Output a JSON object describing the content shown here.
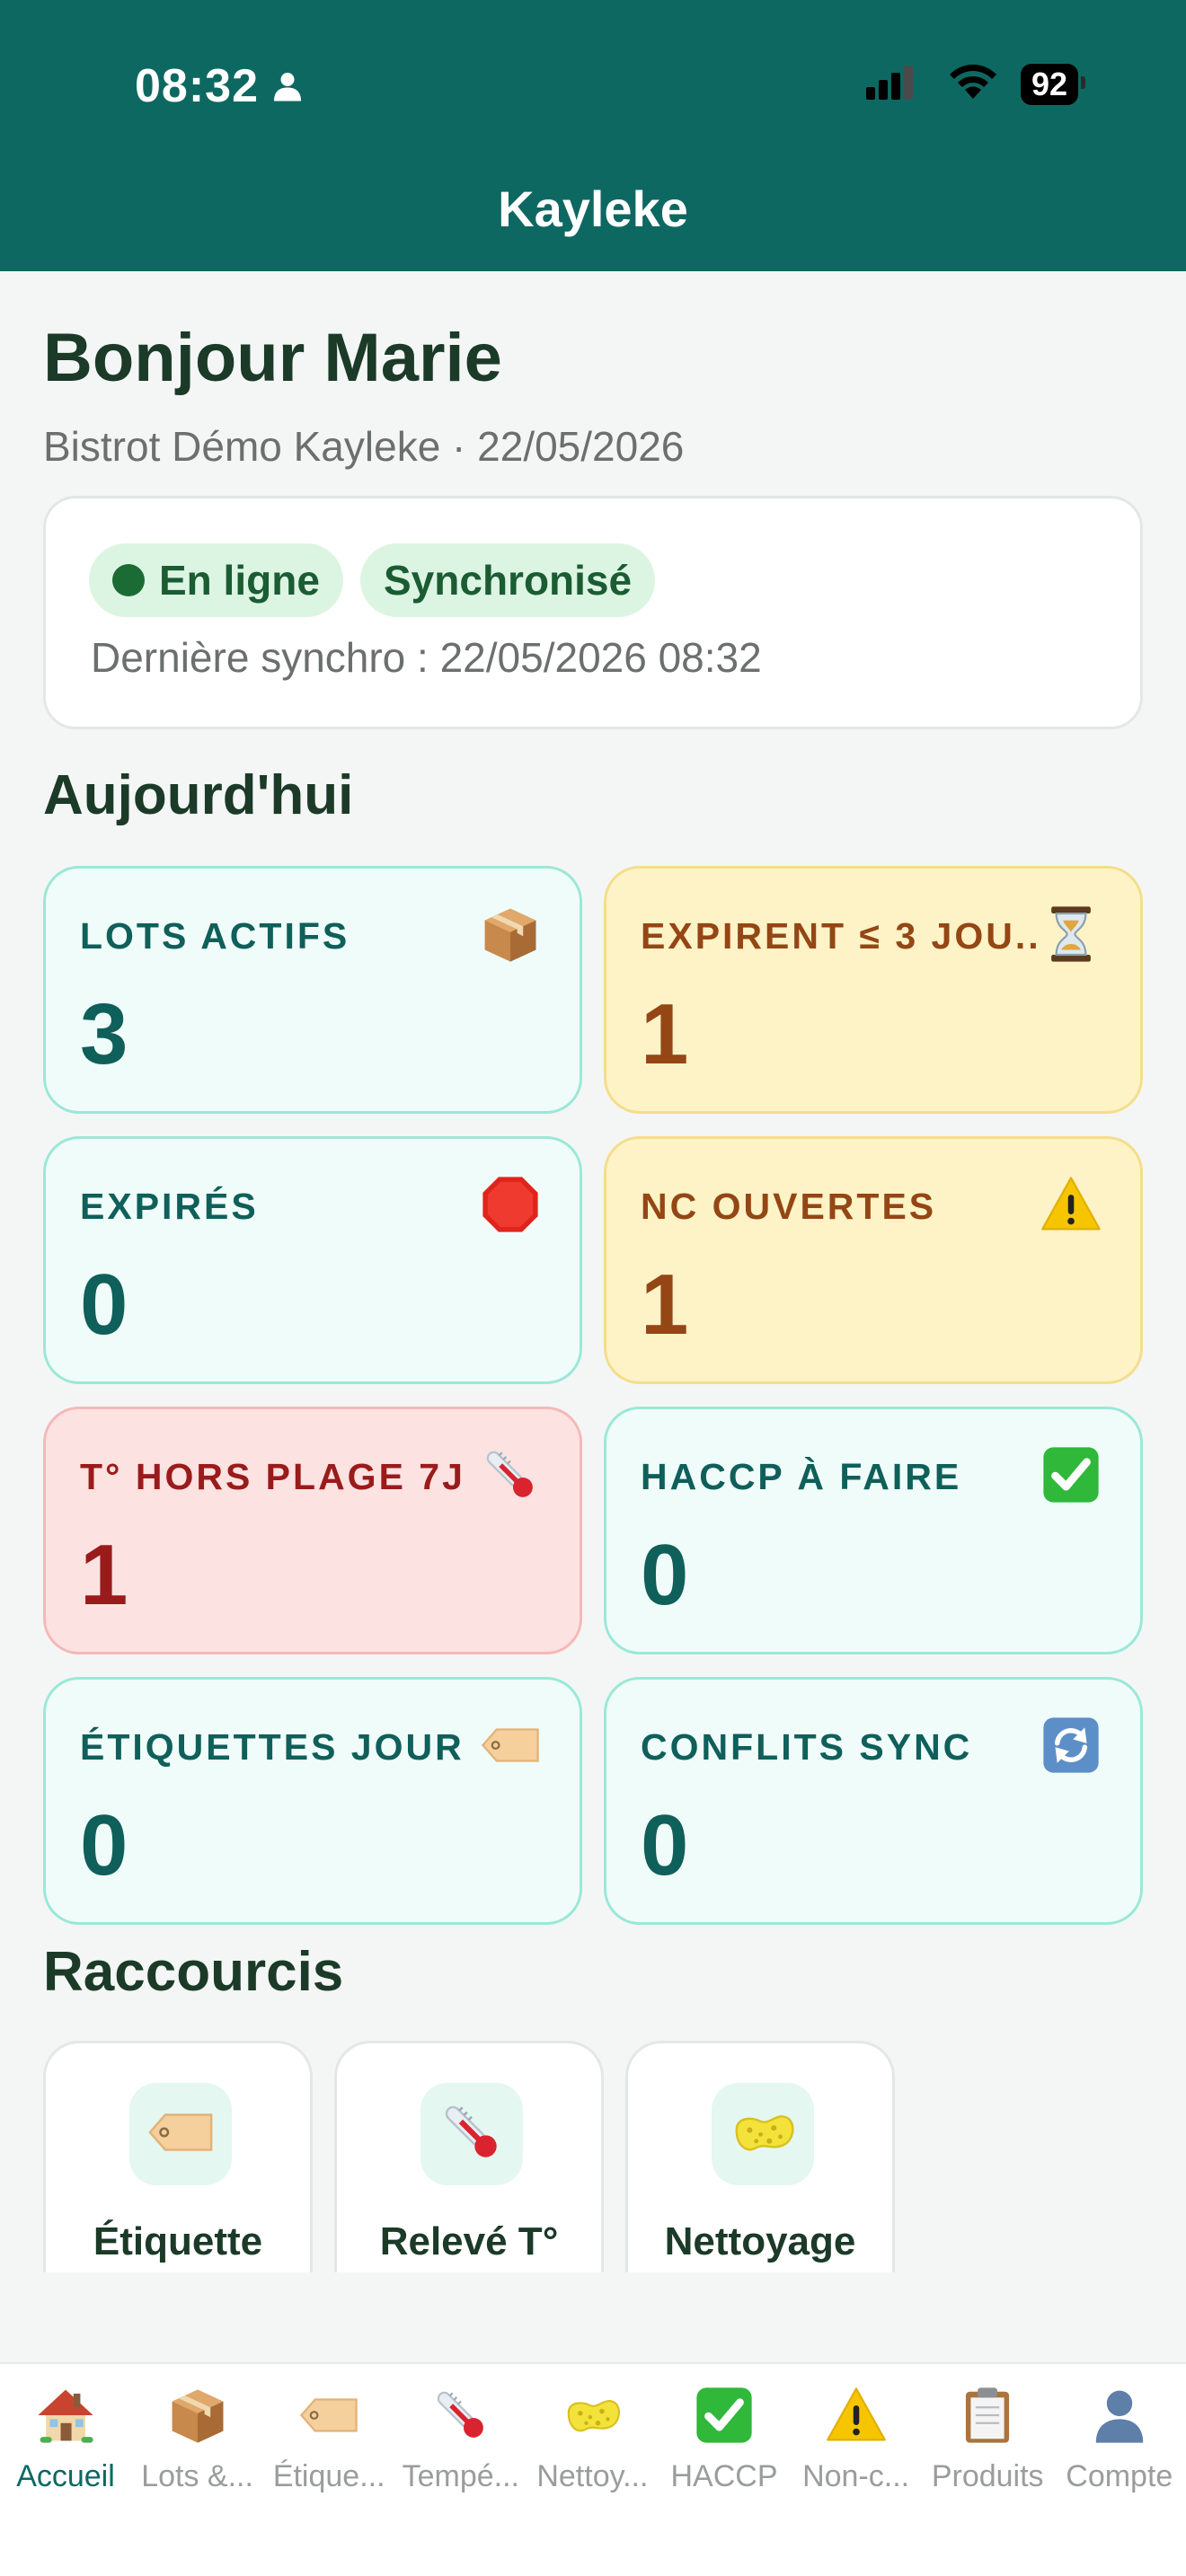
{
  "status_bar": {
    "time": "08:32",
    "battery": "92"
  },
  "header": {
    "title": "Kayleke"
  },
  "greeting": "Bonjour Marie",
  "subtitle": "Bistrot Démo Kayleke · 22/05/2026",
  "sync": {
    "online_label": "En ligne",
    "synced_label": "Synchronisé",
    "last_sync": "Dernière synchro : 22/05/2026 08:32"
  },
  "today": {
    "title": "Aujourd'hui",
    "stats": [
      {
        "label": "LOTS ACTIFS",
        "value": "3",
        "icon": "package-icon",
        "tone": "teal"
      },
      {
        "label": "EXPIRENT ≤ 3 JOU...",
        "value": "1",
        "icon": "hourglass-icon",
        "tone": "amber"
      },
      {
        "label": "EXPIRÉS",
        "value": "0",
        "icon": "stop-sign-icon",
        "tone": "teal"
      },
      {
        "label": "NC OUVERTES",
        "value": "1",
        "icon": "warning-icon",
        "tone": "amber"
      },
      {
        "label": "T° HORS PLAGE 7J",
        "value": "1",
        "icon": "thermometer-icon",
        "tone": "red"
      },
      {
        "label": "HACCP À FAIRE",
        "value": "0",
        "icon": "check-box-icon",
        "tone": "teal"
      },
      {
        "label": "ÉTIQUETTES JOUR",
        "value": "0",
        "icon": "tag-icon",
        "tone": "teal"
      },
      {
        "label": "CONFLITS SYNC",
        "value": "0",
        "icon": "sync-icon",
        "tone": "teal"
      }
    ]
  },
  "shortcuts": {
    "title": "Raccourcis",
    "items": [
      {
        "label": "Étiquette",
        "icon": "tag-icon"
      },
      {
        "label": "Relevé T°",
        "icon": "thermometer-icon"
      },
      {
        "label": "Nettoyage",
        "icon": "sponge-icon"
      }
    ]
  },
  "tabbar": {
    "items": [
      {
        "label": "Accueil",
        "icon": "house-icon",
        "active": true
      },
      {
        "label": "Lots &...",
        "icon": "package-icon"
      },
      {
        "label": "Étique...",
        "icon": "tag-icon"
      },
      {
        "label": "Tempé...",
        "icon": "thermometer-icon"
      },
      {
        "label": "Nettoy...",
        "icon": "sponge-icon"
      },
      {
        "label": "HACCP",
        "icon": "check-box-icon"
      },
      {
        "label": "Non-c...",
        "icon": "warning-icon"
      },
      {
        "label": "Produits",
        "icon": "clipboard-icon"
      },
      {
        "label": "Compte",
        "icon": "person-icon"
      }
    ]
  },
  "colors": {
    "brand": "#0e6862",
    "teal_card": "#f0fcf9",
    "amber_card": "#fdf3c7",
    "red_card": "#fde2e2",
    "online_pill": "#dcf5e3"
  }
}
